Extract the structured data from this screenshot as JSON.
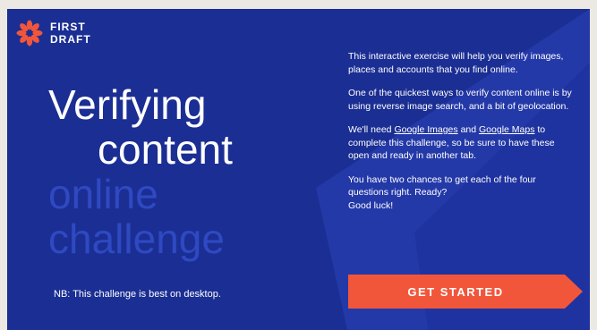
{
  "brand": {
    "line1": "FIRST",
    "line2": "DRAFT",
    "logo_icon": "burst-flower-icon",
    "accent_color": "#f2563a"
  },
  "hero": {
    "title_line1": "Verifying",
    "title_line2": "content",
    "title_line3": "online",
    "title_line4": "challenge"
  },
  "note": "NB: This challenge is best on desktop.",
  "intro": {
    "para1": "This interactive exercise will help you verify images, places and accounts that you find online.",
    "para2": "One of the quickest ways to verify content online is by using reverse image search, and a bit of geolocation.",
    "para3_prefix": "We'll need ",
    "link_google_images": "Google Images",
    "para3_and": " and ",
    "link_google_maps": "Google Maps",
    "para3_suffix": " to complete this challenge, so be sure to have these open and ready in another tab.",
    "para4_line1": "You have two chances to get each of the four questions right. Ready?",
    "para4_line2": "Good luck!"
  },
  "cta": {
    "label": "GET STARTED",
    "color": "#f2563a"
  },
  "colors": {
    "panel_bg": "#1b2e93",
    "shape_light": "#2439a8",
    "title_dim": "#2f49c2"
  }
}
